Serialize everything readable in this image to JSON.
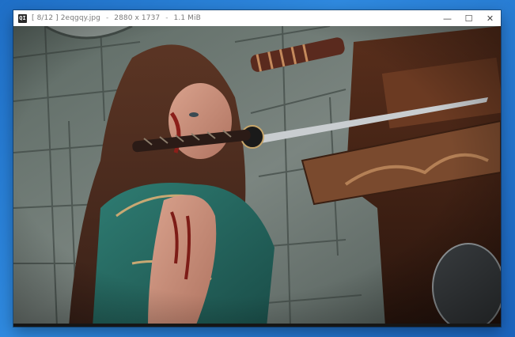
{
  "window": {
    "app_icon_label": "QI",
    "counter": "[ 8/12 ]",
    "filename": "2eqgqy.jpg",
    "dimensions": "2880 x 1737",
    "filesize": "1.1 MiB",
    "separator": "-"
  },
  "controls": {
    "minimize_glyph": "—",
    "maximize_glyph": "☐",
    "close_glyph": "✕"
  },
  "colors": {
    "desktop": "#2a7fd6",
    "titlebar": "#ffffff",
    "viewport": "#2a2a2a"
  }
}
